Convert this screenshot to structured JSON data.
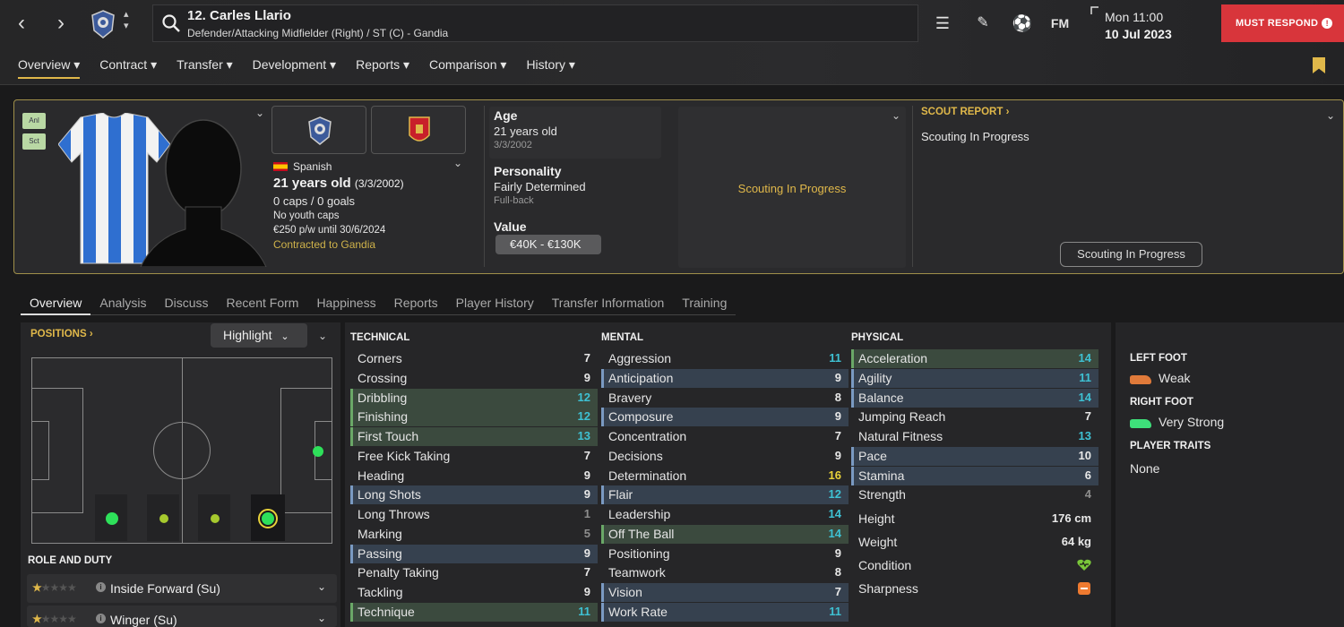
{
  "header": {
    "player_name": "12. Carles Llario",
    "player_subtitle": "Defender/Attacking Midfielder (Right) / ST (C) - Gandia",
    "date_line1": "Mon 11:00",
    "date_line2": "10 Jul 2023",
    "must_respond": "MUST RESPOND",
    "fm_label": "FM",
    "icons": [
      "back-arrow-icon",
      "forward-arrow-icon",
      "club-crest-icon",
      "search-icon",
      "hamburger-menu-icon",
      "edit-pencil-icon",
      "football-icon",
      "fm-logo-icon"
    ]
  },
  "menu": {
    "items": [
      "Overview",
      "Contract",
      "Transfer",
      "Development",
      "Reports",
      "Comparison",
      "History"
    ],
    "active": "Overview"
  },
  "profile": {
    "tags": [
      "Anl",
      "Sct"
    ],
    "nationality": "Spanish",
    "age_main": "21 years old",
    "age_dob": "(3/3/2002)",
    "caps": "0 caps / 0 goals",
    "youth_caps": "No youth caps",
    "wage": "€250 p/w until 30/6/2024",
    "contracted": "Contracted to Gandia",
    "age_label": "Age",
    "age_value": "21 years old",
    "dob": "3/3/2002",
    "personality_label": "Personality",
    "personality_value": "Fairly Determined",
    "position_note": "Full-back",
    "value_label": "Value",
    "value_range": "€40K - €130K",
    "scouting_mid": "Scouting In Progress",
    "scout_report_label": "SCOUT REPORT",
    "scout_report_text": "Scouting In Progress",
    "scout_button": "Scouting In Progress",
    "accent_color": "#e0b84a"
  },
  "tabs": {
    "items": [
      "Overview",
      "Analysis",
      "Discuss",
      "Recent Form",
      "Happiness",
      "Reports",
      "Player History",
      "Transfer Information",
      "Training"
    ],
    "active": "Overview"
  },
  "positions": {
    "label": "POSITIONS",
    "highlight": "Highlight",
    "role_duty_label": "ROLE AND DUTY",
    "roles": [
      {
        "name": "Inside Forward (Su)",
        "stars": 1
      },
      {
        "name": "Winger (Su)",
        "stars": 1
      }
    ]
  },
  "attributes": {
    "technical_label": "TECHNICAL",
    "mental_label": "MENTAL",
    "physical_label": "PHYSICAL",
    "technical": [
      {
        "name": "Corners",
        "value": "7",
        "hl": "",
        "col": "w"
      },
      {
        "name": "Crossing",
        "value": "9",
        "hl": "",
        "col": "w"
      },
      {
        "name": "Dribbling",
        "value": "12",
        "hl": "g",
        "col": "c"
      },
      {
        "name": "Finishing",
        "value": "12",
        "hl": "g",
        "col": "c"
      },
      {
        "name": "First Touch",
        "value": "13",
        "hl": "g",
        "col": "c"
      },
      {
        "name": "Free Kick Taking",
        "value": "7",
        "hl": "",
        "col": "w"
      },
      {
        "name": "Heading",
        "value": "9",
        "hl": "",
        "col": "w"
      },
      {
        "name": "Long Shots",
        "value": "9",
        "hl": "b",
        "col": "w"
      },
      {
        "name": "Long Throws",
        "value": "1",
        "hl": "",
        "col": "d"
      },
      {
        "name": "Marking",
        "value": "5",
        "hl": "",
        "col": "d"
      },
      {
        "name": "Passing",
        "value": "9",
        "hl": "b",
        "col": "w"
      },
      {
        "name": "Penalty Taking",
        "value": "7",
        "hl": "",
        "col": "w"
      },
      {
        "name": "Tackling",
        "value": "9",
        "hl": "",
        "col": "w"
      },
      {
        "name": "Technique",
        "value": "11",
        "hl": "g",
        "col": "c"
      }
    ],
    "mental": [
      {
        "name": "Aggression",
        "value": "11",
        "hl": "",
        "col": "c"
      },
      {
        "name": "Anticipation",
        "value": "9",
        "hl": "b",
        "col": "w"
      },
      {
        "name": "Bravery",
        "value": "8",
        "hl": "",
        "col": "w"
      },
      {
        "name": "Composure",
        "value": "9",
        "hl": "b",
        "col": "w"
      },
      {
        "name": "Concentration",
        "value": "7",
        "hl": "",
        "col": "w"
      },
      {
        "name": "Decisions",
        "value": "9",
        "hl": "",
        "col": "w"
      },
      {
        "name": "Determination",
        "value": "16",
        "hl": "",
        "col": "y"
      },
      {
        "name": "Flair",
        "value": "12",
        "hl": "b",
        "col": "c"
      },
      {
        "name": "Leadership",
        "value": "14",
        "hl": "",
        "col": "c"
      },
      {
        "name": "Off The Ball",
        "value": "14",
        "hl": "g",
        "col": "c"
      },
      {
        "name": "Positioning",
        "value": "9",
        "hl": "",
        "col": "w"
      },
      {
        "name": "Teamwork",
        "value": "8",
        "hl": "",
        "col": "w"
      },
      {
        "name": "Vision",
        "value": "7",
        "hl": "b",
        "col": "w"
      },
      {
        "name": "Work Rate",
        "value": "11",
        "hl": "b",
        "col": "c"
      }
    ],
    "physical": [
      {
        "name": "Acceleration",
        "value": "14",
        "hl": "g",
        "col": "c"
      },
      {
        "name": "Agility",
        "value": "11",
        "hl": "b",
        "col": "c"
      },
      {
        "name": "Balance",
        "value": "14",
        "hl": "b",
        "col": "c"
      },
      {
        "name": "Jumping Reach",
        "value": "7",
        "hl": "",
        "col": "w"
      },
      {
        "name": "Natural Fitness",
        "value": "13",
        "hl": "",
        "col": "c"
      },
      {
        "name": "Pace",
        "value": "10",
        "hl": "b",
        "col": "w"
      },
      {
        "name": "Stamina",
        "value": "6",
        "hl": "b",
        "col": "w"
      },
      {
        "name": "Strength",
        "value": "4",
        "hl": "",
        "col": "d"
      }
    ],
    "height_label": "Height",
    "height_value": "176 cm",
    "weight_label": "Weight",
    "weight_value": "64 kg",
    "condition_label": "Condition",
    "sharpness_label": "Sharpness"
  },
  "feet": {
    "left_label": "LEFT FOOT",
    "left_value": "Weak",
    "right_label": "RIGHT FOOT",
    "right_value": "Very Strong",
    "traits_label": "PLAYER TRAITS",
    "traits_value": "None",
    "left_color": "#e07a3a",
    "right_color": "#3ee07a"
  }
}
